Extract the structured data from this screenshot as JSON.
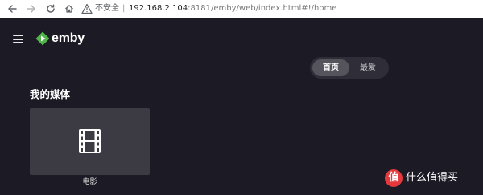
{
  "browser": {
    "security_label": "不安全",
    "url_host": "192.168.2.104",
    "url_rest": ":8181/emby/web/index.html#!/home"
  },
  "app": {
    "logo_text": "emby",
    "brand_color": "#52b54b"
  },
  "tabs": [
    {
      "label": "首页",
      "active": true
    },
    {
      "label": "最爱",
      "active": false
    }
  ],
  "section": {
    "title": "我的媒体",
    "items": [
      {
        "label": "电影",
        "icon": "film-icon"
      }
    ]
  },
  "watermark": {
    "badge": "值",
    "text": "什么值得买"
  }
}
